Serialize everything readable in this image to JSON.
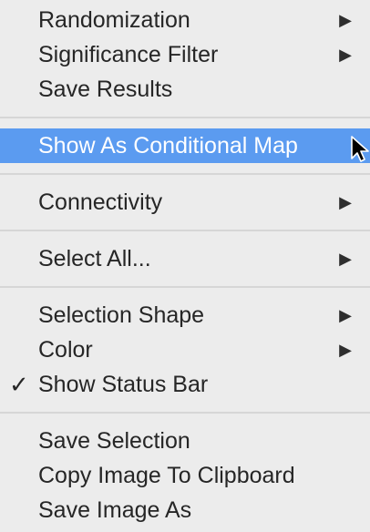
{
  "menu": {
    "groups": [
      [
        {
          "label": "Randomization",
          "submenu": true
        },
        {
          "label": "Significance Filter",
          "submenu": true
        },
        {
          "label": "Save Results",
          "submenu": false
        }
      ],
      [
        {
          "label": "Show As Conditional Map",
          "submenu": false,
          "highlighted": true
        }
      ],
      [
        {
          "label": "Connectivity",
          "submenu": true
        }
      ],
      [
        {
          "label": "Select All...",
          "submenu": true
        }
      ],
      [
        {
          "label": "Selection Shape",
          "submenu": true
        },
        {
          "label": "Color",
          "submenu": true
        },
        {
          "label": "Show Status Bar",
          "submenu": false,
          "checked": true
        }
      ],
      [
        {
          "label": "Save Selection",
          "submenu": false
        },
        {
          "label": "Copy Image To Clipboard",
          "submenu": false
        },
        {
          "label": "Save Image As",
          "submenu": false
        }
      ]
    ],
    "submenu_glyph": "▶",
    "check_glyph": "✓",
    "highlight_color": "#5b9bf0",
    "background_color": "#ececec",
    "text_color": "#262626"
  }
}
